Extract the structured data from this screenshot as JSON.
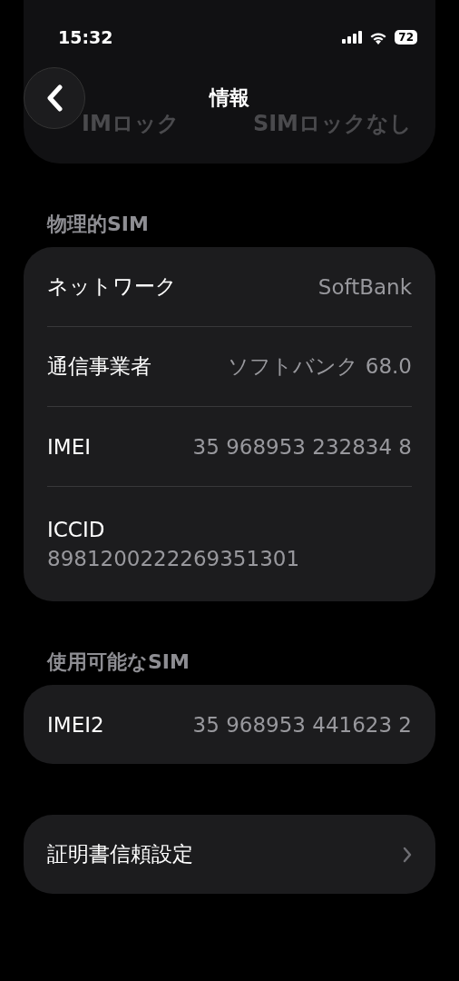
{
  "status_bar": {
    "time": "15:32",
    "battery": "72"
  },
  "header": {
    "title": "情報"
  },
  "top_card": {
    "label": "IMロック",
    "value": "SIMロックなし"
  },
  "sections": [
    {
      "title": "物理的SIM",
      "rows": [
        {
          "kind": "pair",
          "label": "ネットワーク",
          "value": "SoftBank"
        },
        {
          "kind": "pair",
          "label": "通信事業者",
          "value": "ソフトバンク 68.0"
        },
        {
          "kind": "pair",
          "label": "IMEI",
          "value": "35 968953 232834 8"
        },
        {
          "kind": "stacked",
          "label": "ICCID",
          "value": "8981200222269351301"
        }
      ]
    },
    {
      "title": "使用可能なSIM",
      "rows": [
        {
          "kind": "pair",
          "label": "IMEI2",
          "value": "35 968953 441623 2"
        }
      ]
    },
    {
      "rows": [
        {
          "kind": "link",
          "label": "証明書信頼設定"
        }
      ]
    }
  ]
}
